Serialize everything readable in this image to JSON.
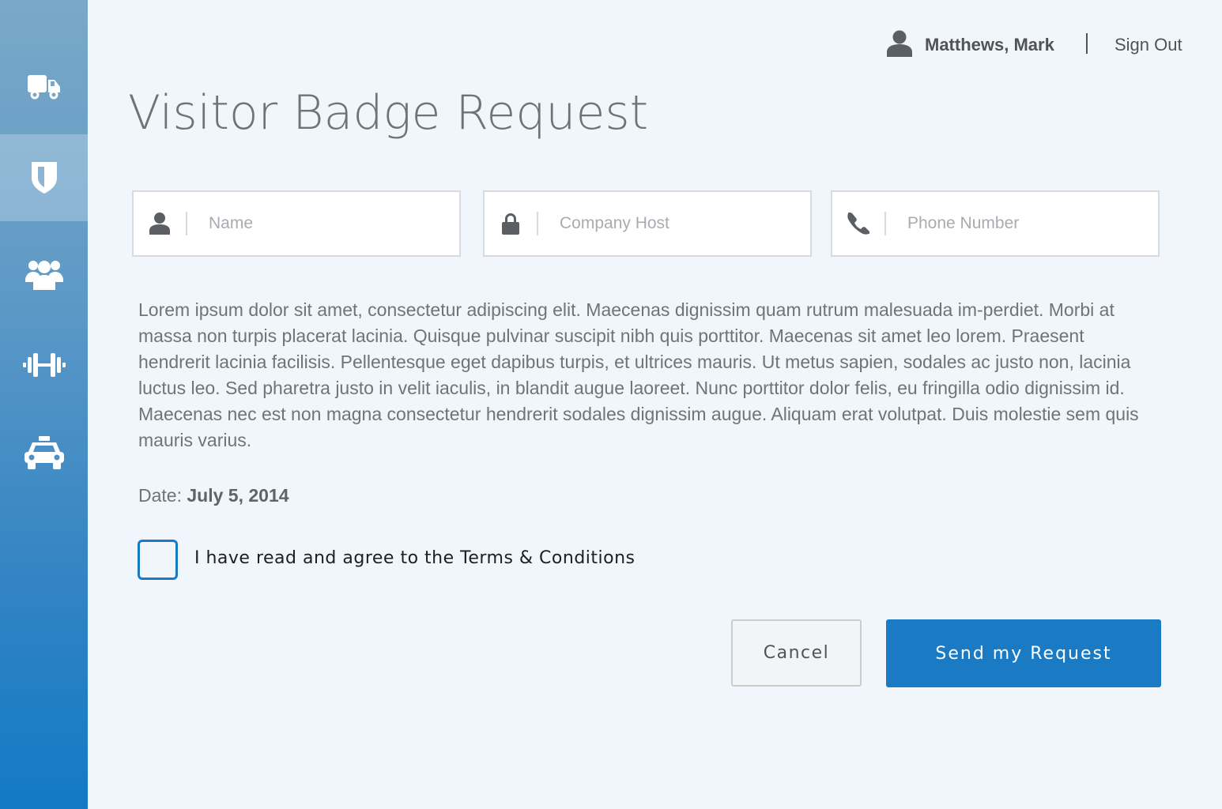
{
  "sidebar": {
    "items": [
      {
        "icon": "truck-icon",
        "active": false
      },
      {
        "icon": "shield-icon",
        "active": true
      },
      {
        "icon": "group-icon",
        "active": false
      },
      {
        "icon": "dumbbell-icon",
        "active": false
      },
      {
        "icon": "taxi-icon",
        "active": false
      }
    ]
  },
  "header": {
    "user_name": "Matthews, Mark",
    "sign_out_label": "Sign Out"
  },
  "page": {
    "title": "Visitor Badge Request"
  },
  "form": {
    "name_placeholder": "Name",
    "name_value": "",
    "company_host_placeholder": "Company Host",
    "company_host_value": "",
    "phone_placeholder": "Phone Number",
    "phone_value": ""
  },
  "body_text": "Lorem ipsum dolor sit amet, consectetur adipiscing elit. Maecenas dignissim quam rutrum malesuada im-perdiet. Morbi at massa non turpis placerat lacinia. Quisque pulvinar suscipit nibh quis porttitor. Maecenas sit amet leo lorem. Praesent hendrerit lacinia facilisis. Pellentesque eget dapibus turpis, et ultrices mauris. Ut metus sapien, sodales ac justo non, lacinia luctus leo. Sed pharetra justo in velit iaculis, in blandit augue laoreet. Nunc porttitor dolor felis, eu fringilla odio dignissim id. Maecenas nec est non magna consectetur hendrerit sodales dignissim augue. Aliquam erat volutpat. Duis molestie sem quis mauris varius.",
  "date": {
    "label": "Date:",
    "value": "July 5, 2014"
  },
  "terms": {
    "label": "I have read and agree to the Terms & Conditions",
    "checked": false
  },
  "actions": {
    "cancel_label": "Cancel",
    "send_label": "Send my Request"
  },
  "colors": {
    "accent": "#1a7ac4",
    "background": "#f1f5fc",
    "text_dark": "#505357"
  }
}
